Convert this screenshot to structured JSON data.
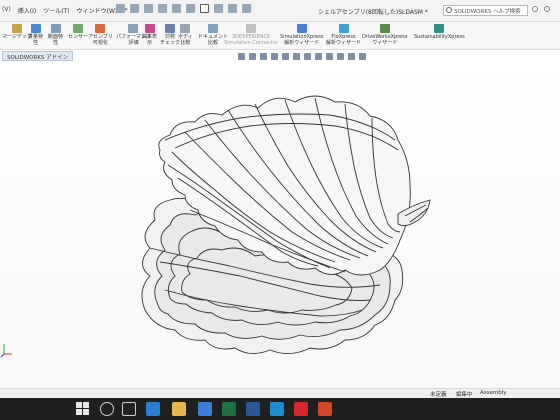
{
  "menu": {
    "items": [
      "(V)",
      "挿入(I)",
      "ツール(T)",
      "ウィンドウ(W)",
      "»"
    ]
  },
  "window": {
    "title": "シェルアセンブリ(8回転した)SLDASM *"
  },
  "search": {
    "placeholder": "SOLIDWORKS ヘルプ検索"
  },
  "ribbon": {
    "buttons": [
      {
        "l1": "マージデップ",
        "l2": "",
        "icon": "merge-icon",
        "color": "#c9a14a",
        "disabled": false
      },
      {
        "l1": "質量特",
        "l2": "性",
        "icon": "mass-properties-icon",
        "color": "#4a8ac9",
        "disabled": false
      },
      {
        "l1": "断面特",
        "l2": "性",
        "icon": "section-properties-icon",
        "color": "#7c9bbd",
        "disabled": false
      },
      {
        "l1": "センサー",
        "l2": "",
        "icon": "sensor-icon",
        "color": "#6fa86a",
        "disabled": false
      },
      {
        "l1": "アセンブリ",
        "l2": "可視化",
        "icon": "assembly-visualization-icon",
        "color": "#d66a3a",
        "disabled": false
      },
      {
        "l1": "パフォーマンス",
        "l2": "評価",
        "icon": "performance-icon",
        "color": "#8aa0b8",
        "disabled": false
      },
      {
        "l1": "曲率表",
        "l2": "示",
        "icon": "curvature-icon",
        "color": "#c94a8a",
        "disabled": false
      },
      {
        "l1": "対称",
        "l2": "チェック",
        "icon": "symmetry-check-icon",
        "color": "#6a7fb0",
        "disabled": false
      },
      {
        "l1": "ボディ",
        "l2": "比較",
        "icon": "compare-icon",
        "color": "#9aa5b3",
        "disabled": false
      },
      {
        "l1": "ドキュメント",
        "l2": "比較",
        "icon": "document-compare-icon",
        "color": "#7fa0c0",
        "disabled": false
      },
      {
        "l1": "3DEXPERIENCE",
        "l2": "Simulation Connector",
        "icon": "3dexperience-icon",
        "color": "#bfbfbf",
        "disabled": true
      },
      {
        "l1": "SimulationXpress",
        "l2": "解析ウィザード",
        "icon": "simulationxpress-icon",
        "color": "#4a7fc9",
        "disabled": false
      },
      {
        "l1": "FloXpress",
        "l2": "解析ウィザード",
        "icon": "floxpress-icon",
        "color": "#3aa0d6",
        "disabled": false
      },
      {
        "l1": "DriveWorksXpress",
        "l2": "ウィザード",
        "icon": "driveworks-icon",
        "color": "#5a8a4a",
        "disabled": false
      },
      {
        "l1": "SustainabilityXpress",
        "l2": "",
        "icon": "sustainability-icon",
        "color": "#2f8f8a",
        "disabled": false
      }
    ]
  },
  "command_tab": {
    "label": "SOLIDWORKS アドイン"
  },
  "status": {
    "editing": "未定義",
    "editing_label": "編集中",
    "doc_type": "Assembly"
  },
  "taskbar": {
    "apps": [
      {
        "name": "cortana-icon",
        "color": "#202020"
      },
      {
        "name": "task-view-icon",
        "color": "#202020"
      },
      {
        "name": "mail-icon",
        "color": "#2b7cd3"
      },
      {
        "name": "file-explorer-icon",
        "color": "#e8b84a"
      },
      {
        "name": "store-icon",
        "color": "#3c7fd6"
      },
      {
        "name": "excel-icon",
        "color": "#1f7244"
      },
      {
        "name": "word-icon",
        "color": "#2b579a"
      },
      {
        "name": "edge-icon",
        "color": "#1e8ed4"
      },
      {
        "name": "solidworks-icon",
        "color": "#d6282d"
      },
      {
        "name": "powerpoint-icon",
        "color": "#d24726"
      }
    ]
  }
}
